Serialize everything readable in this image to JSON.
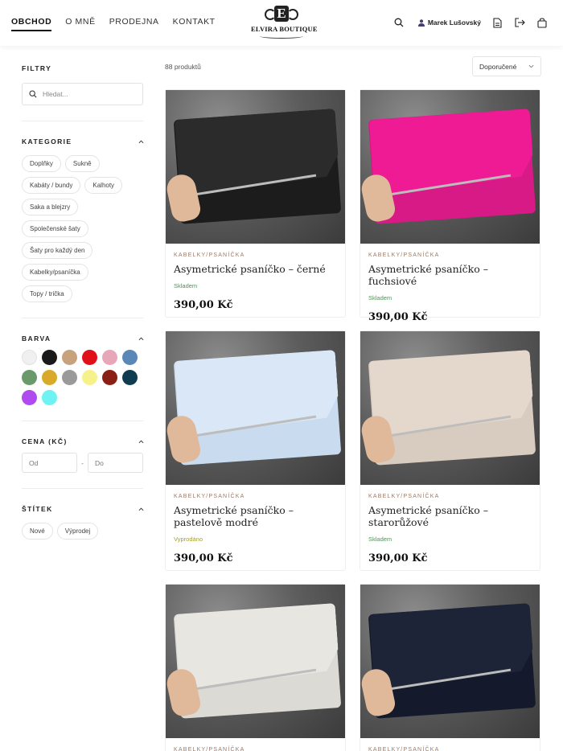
{
  "header": {
    "nav": [
      {
        "label": "OBCHOD",
        "active": true
      },
      {
        "label": "O MNĚ",
        "active": false
      },
      {
        "label": "PRODEJNA",
        "active": false
      },
      {
        "label": "KONTAKT",
        "active": false
      }
    ],
    "logo_letter": "E",
    "logo_text": "ELVIRA BOUTIQUE",
    "user_name": "Marek Lušovský",
    "icons": [
      "search-icon",
      "user-icon",
      "document-icon",
      "logout-icon",
      "cart-icon"
    ]
  },
  "sidebar": {
    "filters_title": "FILTRY",
    "search_placeholder": "Hledat...",
    "categories_title": "KATEGORIE",
    "categories": [
      "Doplňky",
      "Sukně",
      "Kabáty / bundy",
      "Kalhoty",
      "Saka a blejzry",
      "Společenské šaty",
      "Šaty pro každý den",
      "Kabelky/psaníčka",
      "Topy / trička"
    ],
    "color_title": "BARVA",
    "colors": [
      "#f0f0f0",
      "#1a1a1a",
      "#c8a27c",
      "#e0101a",
      "#e8a7b8",
      "#5b87b8",
      "#6a9a6a",
      "#d9a929",
      "#9a9a9a",
      "#f7f18a",
      "#8a1f16",
      "#0f3d4f",
      "#b04bf0",
      "#6ff2f2"
    ],
    "price_title": "CENA (KČ)",
    "price_from": "Od",
    "price_to": "Do",
    "tag_title": "ŠTÍTEK",
    "tags": [
      "Nové",
      "Výprodej"
    ]
  },
  "main": {
    "count": "88 produktů",
    "sort_value": "Doporučené"
  },
  "products": [
    {
      "category": "KABELKY/PSANÍČKA",
      "name": "Asymetrické psaníčko – černé",
      "stock": "Skladem",
      "in_stock": true,
      "price": "390,00 Kč",
      "bag_color": "#1c1c1c",
      "flap_color": "#2b2b2b"
    },
    {
      "category": "KABELKY/PSANÍČKA",
      "name": "Asymetrické psaníčko – fuchsiové",
      "stock": "Skladem",
      "in_stock": true,
      "price": "390,00 Kč",
      "bag_color": "#d81a86",
      "flap_color": "#ee1b95"
    },
    {
      "category": "KABELKY/PSANÍČKA",
      "name": "Asymetrické psaníčko – pastelově modré",
      "stock": "Vyprodáno",
      "in_stock": false,
      "price": "390,00 Kč",
      "bag_color": "#c9dbef",
      "flap_color": "#d9e7f6"
    },
    {
      "category": "KABELKY/PSANÍČKA",
      "name": "Asymetrické psaníčko – starorůžové",
      "stock": "Skladem",
      "in_stock": true,
      "price": "390,00 Kč",
      "bag_color": "#d8cbc0",
      "flap_color": "#e4d8cd"
    },
    {
      "category": "KABELKY/PSANÍČKA",
      "name": "",
      "stock": "",
      "in_stock": true,
      "price": "",
      "bag_color": "#dcdad5",
      "flap_color": "#e8e6e1"
    },
    {
      "category": "KABELKY/PSANÍČKA",
      "name": "",
      "stock": "",
      "in_stock": true,
      "price": "",
      "bag_color": "#141a2b",
      "flap_color": "#1d2438"
    }
  ]
}
